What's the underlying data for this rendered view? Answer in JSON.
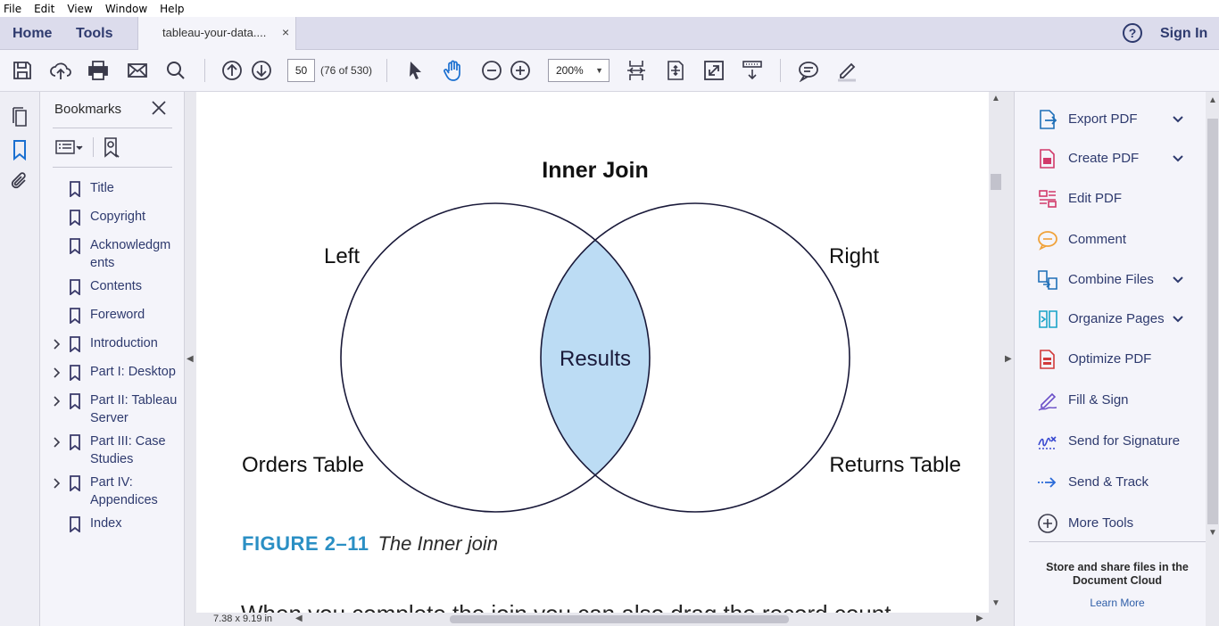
{
  "menu": [
    "File",
    "Edit",
    "View",
    "Window",
    "Help"
  ],
  "tabs": {
    "home": "Home",
    "tools": "Tools",
    "document": "tableau-your-data....",
    "close": "×"
  },
  "header": {
    "help": "?",
    "signin": "Sign In"
  },
  "toolbar": {
    "page_value": "50",
    "page_count": "(76 of 530)",
    "zoom": "200%"
  },
  "bookmarks": {
    "title": "Bookmarks",
    "items": [
      {
        "label": "Title",
        "expandable": false
      },
      {
        "label": "Copyright",
        "expandable": false
      },
      {
        "label": "Acknowledgm ents",
        "expandable": false
      },
      {
        "label": "Contents",
        "expandable": false
      },
      {
        "label": "Foreword",
        "expandable": false
      },
      {
        "label": "Introduction",
        "expandable": true
      },
      {
        "label": "Part I: Desktop",
        "expandable": true
      },
      {
        "label": "Part II: Tableau Server",
        "expandable": true
      },
      {
        "label": "Part III: Case Studies",
        "expandable": true
      },
      {
        "label": "Part IV: Appendices",
        "expandable": true
      },
      {
        "label": "Index",
        "expandable": false
      }
    ]
  },
  "document": {
    "diagram": {
      "title": "Inner Join",
      "left_label": "Left",
      "right_label": "Right",
      "center_label": "Results",
      "left_table": "Orders Table",
      "right_table": "Returns Table",
      "overlap_color": "#bcdcf4"
    },
    "figure_number": "FIGURE 2–11",
    "figure_title": "The Inner join",
    "body_text": "When you complete the join you can also drag the record count",
    "page_size": "7.38 x 9.19 in"
  },
  "tools": [
    {
      "label": "Export PDF",
      "icon": "export-pdf-icon",
      "has_menu": true,
      "color": "#1f6fb8"
    },
    {
      "label": "Create PDF",
      "icon": "create-pdf-icon",
      "has_menu": true,
      "color": "#d13a6a"
    },
    {
      "label": "Edit PDF",
      "icon": "edit-pdf-icon",
      "has_menu": false,
      "color": "#d13a6a"
    },
    {
      "label": "Comment",
      "icon": "comment-icon",
      "has_menu": false,
      "color": "#f0a23a"
    },
    {
      "label": "Combine Files",
      "icon": "combine-files-icon",
      "has_menu": true,
      "color": "#1f6fb8"
    },
    {
      "label": "Organize Pages",
      "icon": "organize-pages-icon",
      "has_menu": true,
      "color": "#1aa3c8"
    },
    {
      "label": "Optimize PDF",
      "icon": "optimize-pdf-icon",
      "has_menu": false,
      "color": "#d13a3a"
    },
    {
      "label": "Fill & Sign",
      "icon": "fill-sign-icon",
      "has_menu": false,
      "color": "#6a4fc8"
    },
    {
      "label": "Send for Signature",
      "icon": "send-for-signature-icon",
      "has_menu": false,
      "color": "#3a4ad0"
    },
    {
      "label": "Send & Track",
      "icon": "send-track-icon",
      "has_menu": false,
      "color": "#2a6ad8"
    },
    {
      "label": "More Tools",
      "icon": "more-tools-icon",
      "has_menu": false,
      "color": "#3a3a4a"
    }
  ],
  "cloud": {
    "title": "Store and share files in the Document Cloud",
    "link": "Learn More"
  }
}
